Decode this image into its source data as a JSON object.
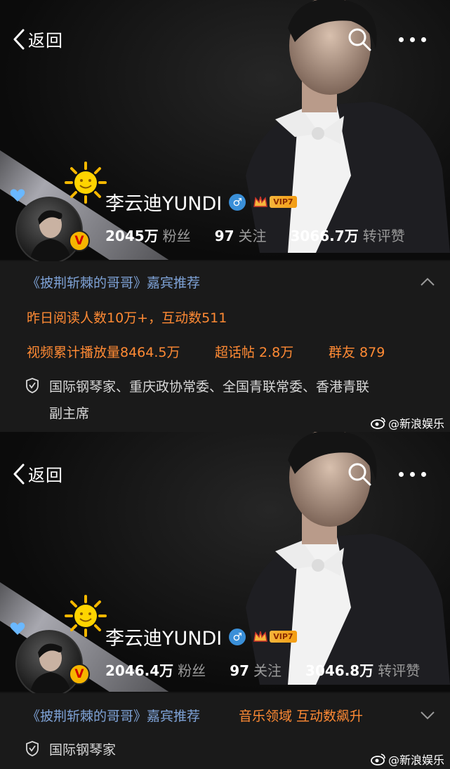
{
  "panels": [
    {
      "nav": {
        "back_label": "返回"
      },
      "profile": {
        "name": "李云迪YUNDI",
        "gender_symbol": "♂",
        "vip_label": "VIP7",
        "vbadge": "V"
      },
      "stats": [
        {
          "value": "2045万",
          "label": "粉丝"
        },
        {
          "value": "97",
          "label": "关注"
        },
        {
          "value": "3066.7万",
          "label": "转评赞"
        }
      ],
      "recommend": "《披荆斩棘的哥哥》嘉宾推荐",
      "reads": "昨日阅读人数10万+，互动数511",
      "video": "视频累计播放量8464.5万",
      "supertopic": "超话帖 2.8万",
      "group": "群友 879",
      "bio_line1": "国际钢琴家、重庆政协常委、全国青联常委、香港青联",
      "bio_line2": "副主席",
      "watermark": "@新浪娱乐"
    },
    {
      "nav": {
        "back_label": "返回"
      },
      "profile": {
        "name": "李云迪YUNDI",
        "gender_symbol": "♂",
        "vip_label": "VIP7",
        "vbadge": "V"
      },
      "stats": [
        {
          "value": "2046.4万",
          "label": "粉丝"
        },
        {
          "value": "97",
          "label": "关注"
        },
        {
          "value": "3046.8万",
          "label": "转评赞"
        }
      ],
      "recommend": "《披荆斩棘的哥哥》嘉宾推荐",
      "domain_tag": "音乐领域 互动数飙升",
      "bio_line1": "国际钢琴家",
      "watermark": "@新浪娱乐"
    }
  ],
  "icons": [
    "chevron-left-icon",
    "search-icon",
    "more-icon",
    "heart-icon",
    "sun-icon",
    "gender-male-icon",
    "vip-crown-icon",
    "shield-icon",
    "chevron-up-icon",
    "chevron-down-icon",
    "weibo-eye-icon"
  ],
  "colors": {
    "accent_orange": "#ff8a34",
    "link_blue": "#7ea2d6",
    "gender_blue": "#3a8fd8",
    "vip_gold": "#f6b63c"
  }
}
